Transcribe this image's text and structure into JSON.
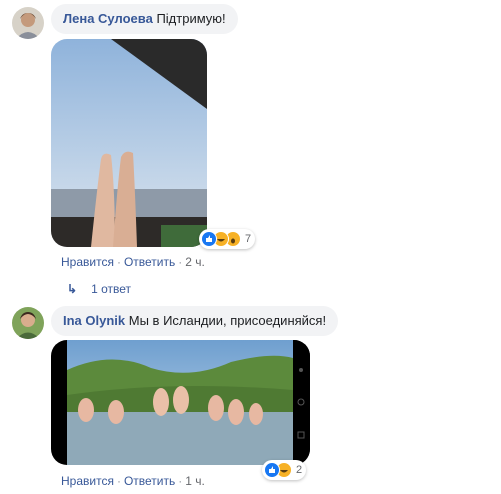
{
  "comments": [
    {
      "author": "Лена Сулоева",
      "text": "Підтримую!",
      "reaction_count": "7",
      "reactions": [
        "like-icon",
        "haha-icon",
        "wow-icon"
      ],
      "actions": {
        "like": "Нравится",
        "reply": "Ответить",
        "time": "2 ч."
      },
      "replies_label": "1 ответ"
    },
    {
      "author": "Ina Olynik",
      "text": "Мы в Исландии, присоединяйся!",
      "reaction_count": "2",
      "reactions": [
        "like-icon",
        "haha-icon"
      ],
      "actions": {
        "like": "Нравится",
        "reply": "Ответить",
        "time": "1 ч."
      }
    }
  ],
  "colors": {
    "link": "#385898",
    "bubble": "#f2f3f5",
    "meta": "#65676b",
    "like": "#1877f2",
    "haha": "#f7b125"
  }
}
